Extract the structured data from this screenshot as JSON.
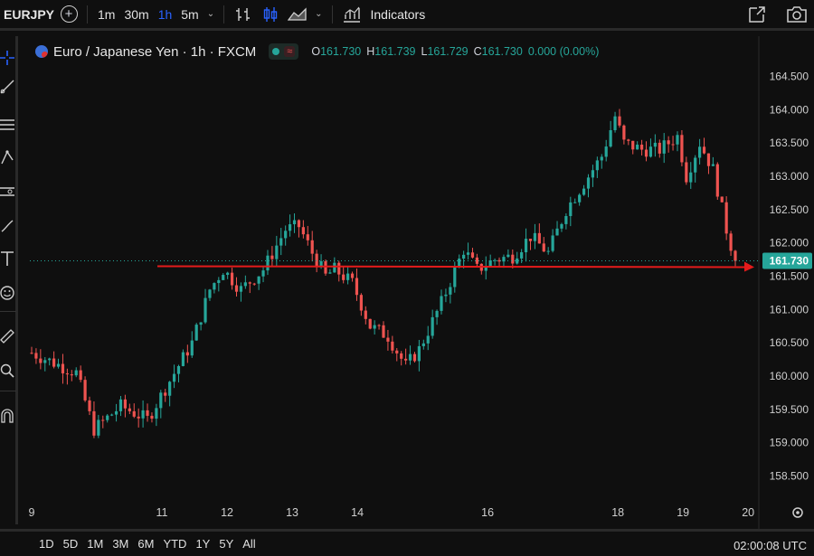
{
  "toolbar": {
    "symbol": "EURJPY",
    "intervals": [
      "1m",
      "30m",
      "1h",
      "5m"
    ],
    "active_interval": "1h",
    "indicators_label": "Indicators"
  },
  "legend": {
    "title": "Euro / Japanese Yen · 1h · FXCM",
    "ohlc": [
      {
        "k": "O",
        "v": "161.730"
      },
      {
        "k": "H",
        "v": "161.739"
      },
      {
        "k": "L",
        "v": "161.729"
      },
      {
        "k": "C",
        "v": "161.730"
      },
      {
        "k": "",
        "v": "0.000 (0.00%)"
      }
    ]
  },
  "colors": {
    "up": "#26a69a",
    "down": "#ef5350",
    "line": "#e31b1b",
    "active": "#2962ff"
  },
  "bottom": {
    "ranges": [
      "1D",
      "5D",
      "1M",
      "3M",
      "6M",
      "YTD",
      "1Y",
      "5Y",
      "All"
    ],
    "clock": "02:00:08 UTC"
  },
  "chart_data": {
    "type": "candlestick",
    "x_ticks": [
      {
        "label": "9",
        "day": 9
      },
      {
        "label": "11",
        "day": 11
      },
      {
        "label": "12",
        "day": 12
      },
      {
        "label": "13",
        "day": 13
      },
      {
        "label": "14",
        "day": 14
      },
      {
        "label": "16",
        "day": 16
      },
      {
        "label": "18",
        "day": 18
      },
      {
        "label": "19",
        "day": 19
      },
      {
        "label": "20",
        "day": 20
      }
    ],
    "y_ticks": [
      "164.500",
      "164.000",
      "163.500",
      "163.000",
      "162.500",
      "162.000",
      "161.500",
      "161.000",
      "160.500",
      "160.000",
      "159.500",
      "159.000",
      "158.500"
    ],
    "ylim": [
      158.25,
      164.75
    ],
    "last_price": "161.730",
    "horizontal_line": {
      "price": 161.65
    },
    "close_path": [
      [
        0,
        160.35
      ],
      [
        10,
        160.05
      ],
      [
        14,
        159.2
      ],
      [
        20,
        159.55
      ],
      [
        26,
        159.35
      ],
      [
        29,
        159.7
      ],
      [
        36,
        160.5
      ],
      [
        40,
        161.3
      ],
      [
        43,
        161.6
      ],
      [
        47,
        161.3
      ],
      [
        52,
        161.6
      ],
      [
        57,
        162.2
      ],
      [
        60,
        162.25
      ],
      [
        63,
        161.85
      ],
      [
        66,
        161.5
      ],
      [
        68,
        161.6
      ],
      [
        72,
        161.4
      ],
      [
        76,
        160.75
      ],
      [
        80,
        160.6
      ],
      [
        84,
        160.15
      ],
      [
        87,
        160.4
      ],
      [
        92,
        161.1
      ],
      [
        97,
        161.9
      ],
      [
        100,
        161.6
      ],
      [
        104,
        161.75
      ],
      [
        108,
        161.8
      ],
      [
        112,
        162.1
      ],
      [
        116,
        161.85
      ],
      [
        120,
        162.5
      ],
      [
        124,
        162.9
      ],
      [
        128,
        163.3
      ],
      [
        131,
        163.9
      ],
      [
        133,
        163.5
      ],
      [
        137,
        163.4
      ],
      [
        141,
        163.4
      ],
      [
        145,
        163.6
      ],
      [
        147,
        163.0
      ],
      [
        150,
        163.5
      ],
      [
        153,
        163.1
      ],
      [
        156,
        162.2
      ],
      [
        158,
        161.73
      ]
    ]
  }
}
